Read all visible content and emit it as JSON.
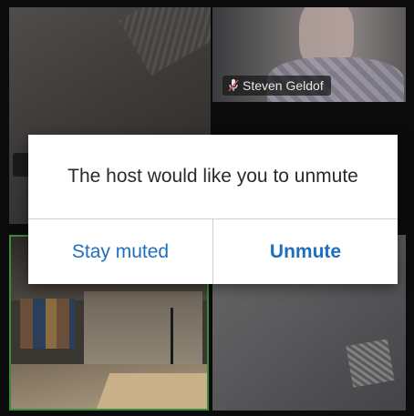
{
  "participants": {
    "named": {
      "name": "Steven Geldof",
      "mic_icon": "muted-mic-icon"
    }
  },
  "dialog": {
    "message": "The host would like you to unmute",
    "stay_muted_label": "Stay muted",
    "unmute_label": "Unmute"
  },
  "colors": {
    "accent": "#1f6fbf",
    "active_speaker_border": "#3c8a3c"
  }
}
